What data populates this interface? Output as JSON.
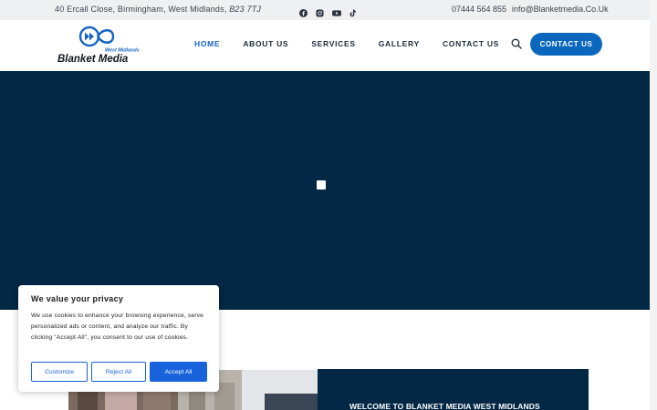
{
  "topbar": {
    "address": "40 Ercall Close, Birmingham, West Midlands, ",
    "postcode": "B23 7TJ",
    "social": [
      "facebook-icon",
      "instagram-icon",
      "youtube-icon",
      "tiktok-icon"
    ],
    "phone": "07444 564 855",
    "email": "info@Blanketmedia.Co.Uk"
  },
  "brand": {
    "name": "Blanket Media",
    "tagline": "West Midlands",
    "color": "#1565c0"
  },
  "nav": {
    "items": [
      {
        "label": "HOME",
        "active": true
      },
      {
        "label": "ABOUT US",
        "active": false
      },
      {
        "label": "SERVICES",
        "active": false
      },
      {
        "label": "GALLERY",
        "active": false
      },
      {
        "label": "CONTACT US",
        "active": false
      }
    ],
    "cta_label": "CONTACT US"
  },
  "hero": {
    "background": "#022846",
    "loading_icon": "loading-square-icon"
  },
  "welcome": {
    "title": "WELCOME TO BLANKET MEDIA WEST MIDLANDS"
  },
  "cookie_banner": {
    "title": "We value your privacy",
    "body": "We use cookies to enhance your browsing experience, serve personalized ads or content, and analyze our traffic. By clicking \"Accept All\", you consent to our use of cookies.",
    "customize_label": "Customize",
    "reject_label": "Reject All",
    "accept_label": "Accept All",
    "accent": "#1863dc"
  }
}
